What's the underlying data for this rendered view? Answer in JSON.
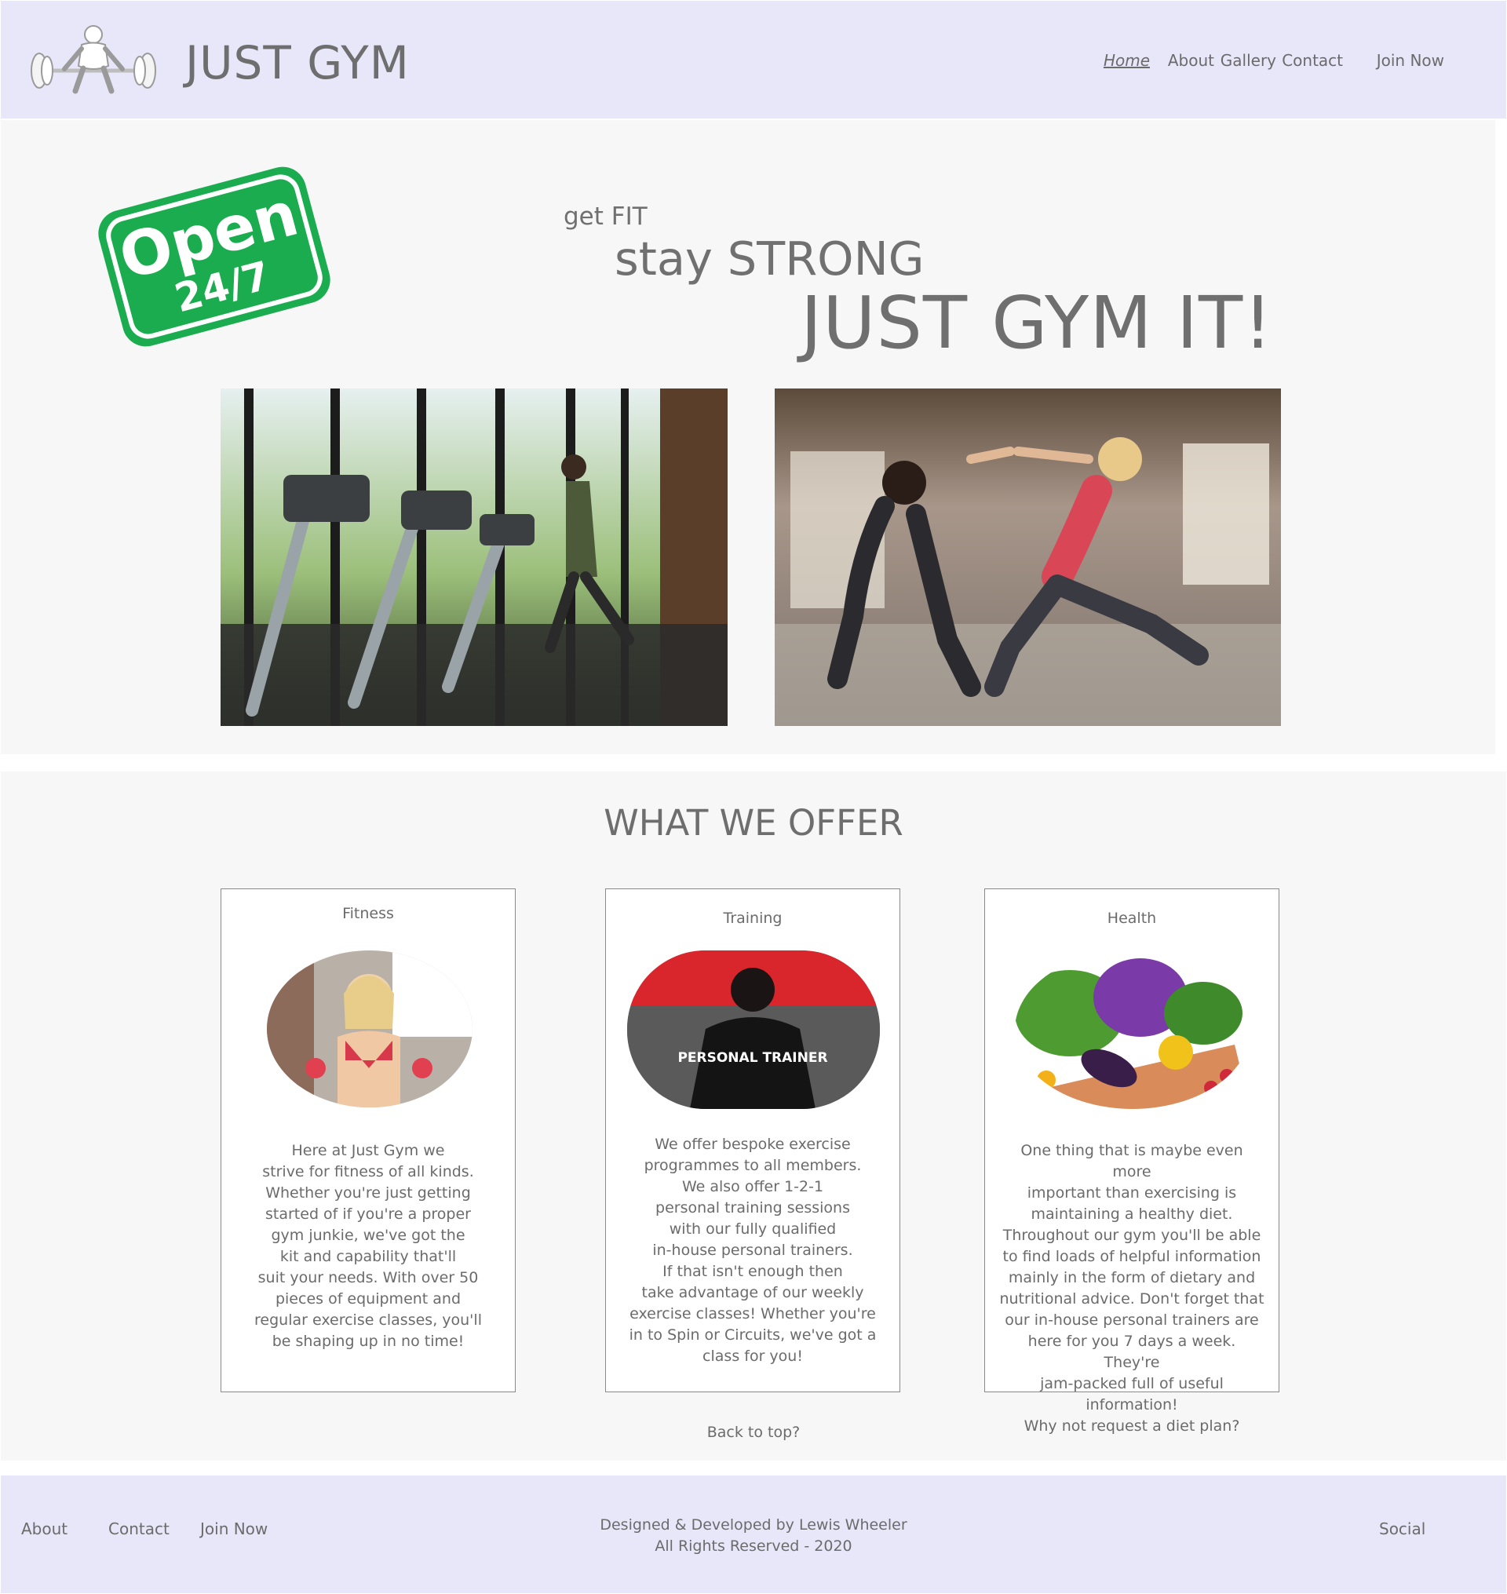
{
  "header": {
    "brand": "JUST GYM",
    "nav": [
      "Home",
      "About",
      "Gallery",
      "Contact",
      "Join Now"
    ],
    "active_nav": "Home"
  },
  "hero": {
    "sticker": {
      "line1": "Open",
      "line2": "24/7"
    },
    "tagline_1": "get FIT",
    "tagline_2": "stay STRONG",
    "tagline_3": "JUST GYM IT!"
  },
  "offer": {
    "title": "WHAT WE OFFER",
    "cards": [
      {
        "title": "Fitness",
        "text": "Here at Just Gym we\nstrive for fitness of all kinds.\nWhether you're just getting\nstarted of if you're a proper\ngym junkie, we've got the\nkit and capability that'll\nsuit your needs. With over 50\npieces of equipment and\nregular exercise classes, you'll\nbe shaping up in no time!"
      },
      {
        "title": "Training",
        "image_text": "PERSONAL TRAINER",
        "text": "We offer bespoke exercise\nprogrammes to all members.\nWe also offer 1-2-1\npersonal training sessions\nwith our fully qualified\nin-house personal trainers.\nIf that isn't enough then\ntake advantage of our weekly\nexercise classes! Whether you're\nin to Spin or Circuits, we've got a\nclass for you!"
      },
      {
        "title": "Health",
        "text": "One thing that is maybe even more\nimportant than exercising is\nmaintaining a healthy diet.\nThroughout our gym you'll be able\nto find loads of helpful information\nmainly in the form of dietary and\nnutritional advice. Don't forget that\nour in-house personal trainers are\nhere for you 7 days a week. They're\njam-packed full of useful information!\nWhy not request a diet plan?"
      }
    ],
    "back_to_top": "Back to top?"
  },
  "footer": {
    "links": [
      "About",
      "Contact",
      "Join Now"
    ],
    "credit_line1": "Designed & Developed by Lewis Wheeler",
    "credit_line2": "All Rights Reserved - 2020",
    "social": "Social"
  },
  "colors": {
    "header_bg": "#e8e7f9",
    "section_bg": "#f7f7f7",
    "text": "#6b6b6b",
    "sticker_green": "#1aac4e"
  }
}
